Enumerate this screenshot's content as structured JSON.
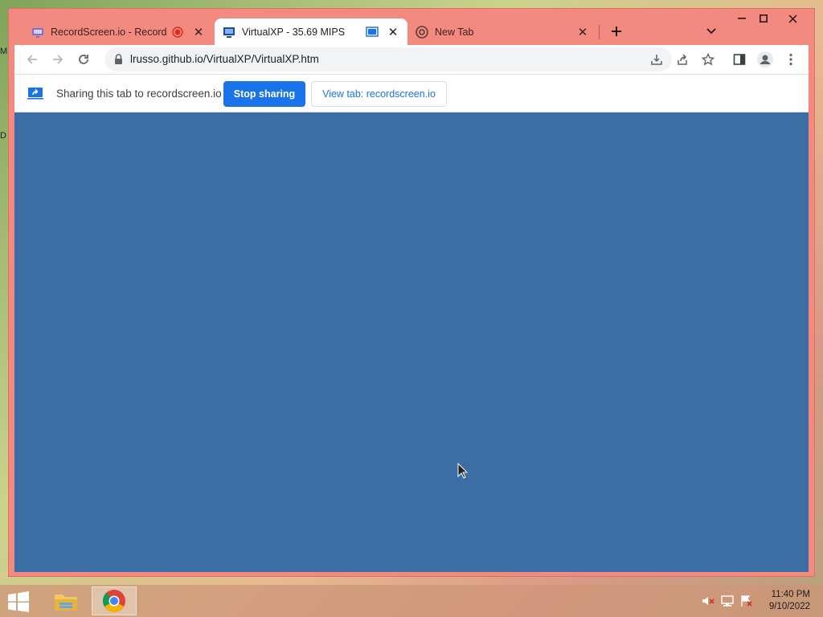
{
  "desktop": {
    "edge_text_1": "M",
    "edge_text_2": "D"
  },
  "tabs": [
    {
      "title": "RecordScreen.io - Record yo",
      "favicon": "recordscreen-icon",
      "recording": true
    },
    {
      "title": "VirtualXP - 35.69 MIPS",
      "favicon": "virtualxp-icon",
      "active": true
    },
    {
      "title": "New Tab",
      "favicon": "chrome-icon"
    }
  ],
  "address_bar": {
    "url": "lrusso.github.io/VirtualXP/VirtualXP.htm"
  },
  "infobar": {
    "message": "Sharing this tab to recordscreen.io",
    "stop_label": "Stop sharing",
    "view_label": "View tab: recordscreen.io"
  },
  "colors": {
    "page_background": "#3a6ea5",
    "frame": "#f28a7f",
    "primary_button": "#1a73e8"
  },
  "taskbar": {
    "apps": [
      "file-explorer-icon",
      "chrome-icon"
    ],
    "tray": [
      "volume-muted-icon",
      "network-icon",
      "action-center-flag-icon"
    ],
    "time": "11:40 PM",
    "date": "9/10/2022"
  }
}
